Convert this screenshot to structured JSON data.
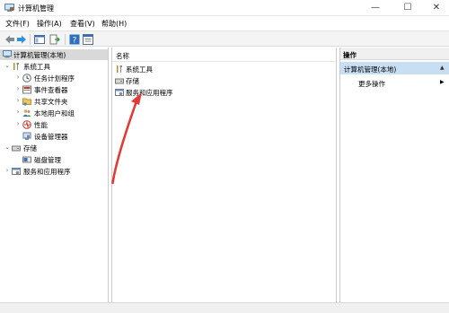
{
  "window": {
    "title": "计算机管理",
    "minimize": "—",
    "maximize": "☐",
    "close": "✕"
  },
  "menu": [
    "文件(F)",
    "操作(A)",
    "查看(V)",
    "帮助(H)"
  ],
  "tree": {
    "root": "计算机管理(本地)",
    "system_tools": "系统工具",
    "task_scheduler": "任务计划程序",
    "event_viewer": "事件查看器",
    "shared_folders": "共享文件夹",
    "local_users": "本地用户和组",
    "performance": "性能",
    "device_manager": "设备管理器",
    "storage": "存储",
    "disk_management": "磁盘管理",
    "services_apps": "服务和应用程序"
  },
  "list": {
    "header": "名称",
    "items": [
      "系统工具",
      "存储",
      "服务和应用程序"
    ]
  },
  "actions": {
    "header": "操作",
    "selected": "计算机管理(本地)",
    "more": "更多操作"
  },
  "colors": {
    "selection": "#c7def3",
    "arrow": "#e03a3a"
  }
}
